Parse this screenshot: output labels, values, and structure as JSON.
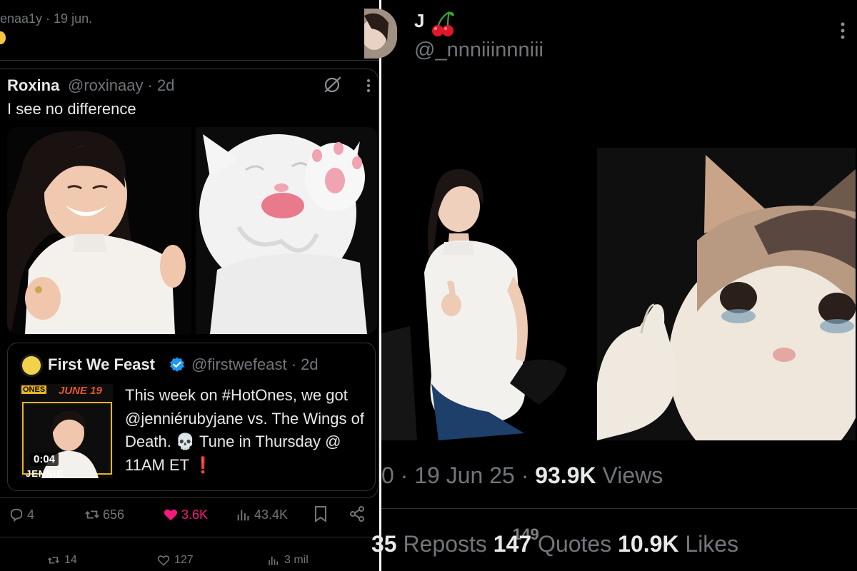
{
  "left_post": {
    "top_meta": "enaa1y · 19 jun.",
    "quoted": {
      "name": "Roxina",
      "handle": "@roxinaay · 2d",
      "text": "I see no difference",
      "nested_quote": {
        "name": "First We Feast",
        "handle": "@firstwefeast · 2d",
        "text": "This week on #HotOnes, we got @jenniérubyjane vs. The Wings of Death. 💀 Tune in Thursday @ 11AM ET ❗",
        "thumb_date": "JUNE 19",
        "thumb_brand": "ONES",
        "thumb_name": "JENNIE",
        "duration": "0:04"
      }
    },
    "actions": {
      "replies": "4",
      "reposts": "656",
      "likes": "3.6K",
      "views": "43.4K"
    },
    "actions_bottom": {
      "reposts": "14",
      "likes": "127",
      "views": "3 mil"
    }
  },
  "right_post": {
    "name": "J",
    "handle": "@_nnniiinnniii",
    "meta_prefix": "0 · 19 Jun 25 · ",
    "views_count": "93.9K",
    "views_label": " Views",
    "stats": {
      "reposts_count": "35",
      "reposts_label": " Reposts  ",
      "quotes_count": "147",
      "quotes_ghost": "149",
      "quotes_label": " Quotes  ",
      "likes_count": "10.9K",
      "likes_label": " Likes"
    }
  },
  "colors": {
    "text": "#e7e9ea",
    "muted": "#71767b",
    "like_pink": "#f91880",
    "verified_blue": "#1d9bf0",
    "thumb_orange": "#e8552a"
  }
}
